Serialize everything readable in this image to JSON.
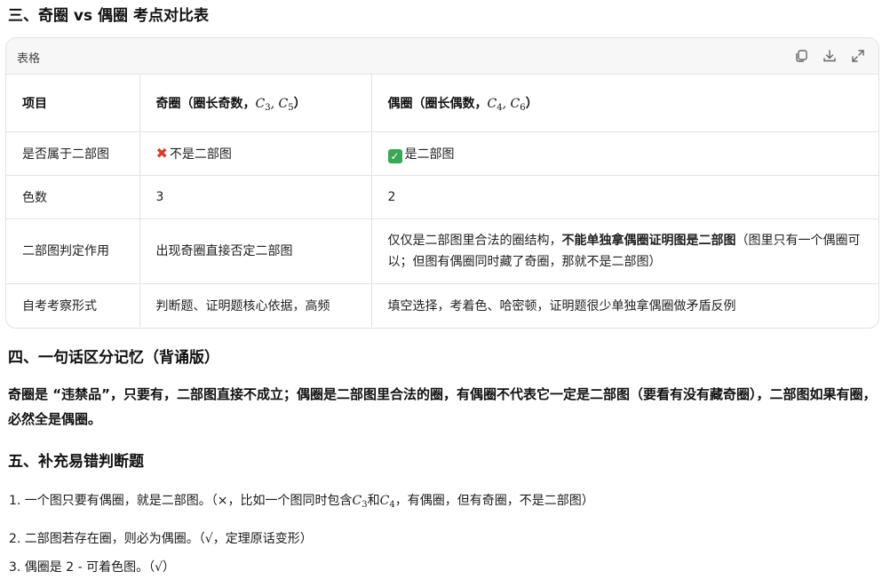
{
  "sections": {
    "three_title": "三、奇圈 vs 偶圈 考点对比表",
    "four_title": "四、一句话区分记忆（背诵版）",
    "five_title": "五、补充易错判断题"
  },
  "table_card": {
    "label": "表格",
    "icons": [
      "copy-icon",
      "download-icon",
      "expand-icon"
    ]
  },
  "table": {
    "headers": {
      "col1": "项目",
      "col2_text": "奇圈（圈长奇数，",
      "col2_m1": "C",
      "col2_s1": "3",
      "col2_m2": "C",
      "col2_s2": "5",
      "col2_close": "）",
      "col3_text": "偶圈（圈长偶数，",
      "col3_m1": "C",
      "col3_s1": "4",
      "col3_m2": "C",
      "col3_s2": "6",
      "col3_close": "）",
      "comma": ","
    },
    "rows": [
      {
        "item": "是否属于二部图",
        "odd_mark": "✖",
        "odd": "不是二部图",
        "even_mark": "✓",
        "even": "是二部图"
      },
      {
        "item": "色数",
        "odd": "3",
        "even": "2"
      },
      {
        "item": "二部图判定作用",
        "odd": "出现奇圈直接否定二部图",
        "even_pre": "仅仅是二部图里合法的圈结构，",
        "even_bold": "不能单独拿偶圈证明图是二部图",
        "even_post": "（图里只有一个偶圈可以；但图有偶圈同时藏了奇圈，那就不是二部图）"
      },
      {
        "item": "自考考察形式",
        "odd": "判断题、证明题核心依据，高频",
        "even": "填空选择，考着色、哈密顿，证明题很少单独拿偶圈做矛盾反例"
      }
    ]
  },
  "memory_text": "奇圈是 “违禁品”，只要有，二部图直接不成立；偶圈是二部图里合法的圈，有偶圈不代表它一定是二部图（要看有没有藏奇圈），二部图如果有圈，必然全是偶圈。",
  "list": {
    "item1_pre": "1. 一个图只要有偶圈，就是二部图。（×，比如一个图同时包含",
    "item1_m1": "C",
    "item1_s1": "3",
    "item1_and": "和",
    "item1_m2": "C",
    "item1_s2": "4",
    "item1_post": "，有偶圈，但有奇圈，不是二部图）",
    "item2": "2. 二部图若存在圈，则必为偶圈。（√，定理原话变形）",
    "item3": "3. 偶圈是 2 - 可着色图。（√）"
  }
}
